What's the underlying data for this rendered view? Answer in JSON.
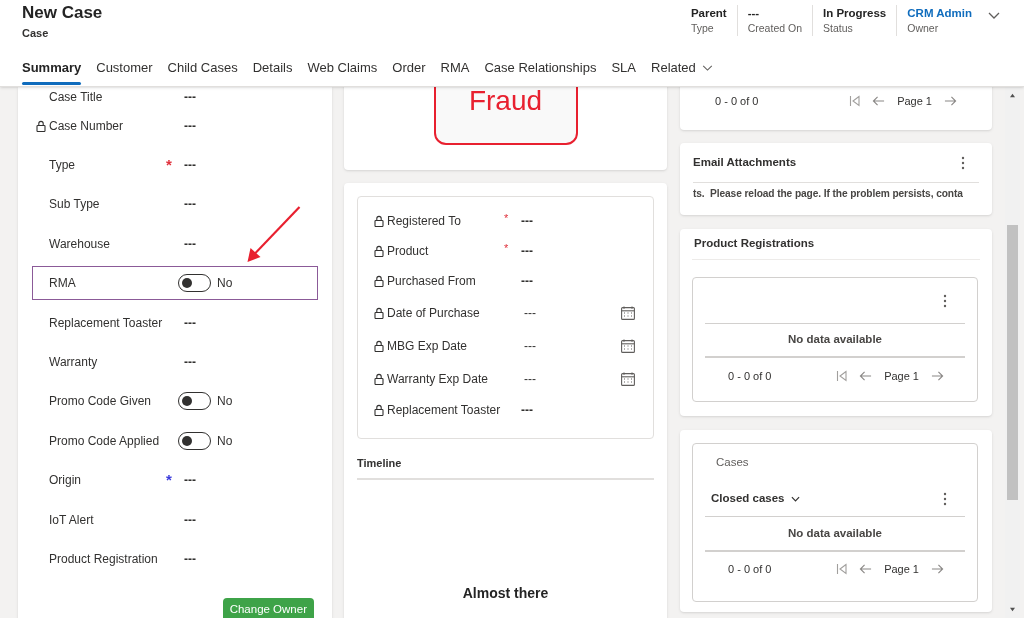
{
  "header": {
    "title": "New Case",
    "subtitle": "Case",
    "fields": [
      {
        "value": "Parent",
        "label": "Type",
        "kind": "text"
      },
      {
        "value": "---",
        "label": "Created On",
        "kind": "text"
      },
      {
        "value": "In Progress",
        "label": "Status",
        "kind": "text"
      },
      {
        "value": "CRM Admin",
        "label": "Owner",
        "kind": "link"
      }
    ],
    "tabs": [
      {
        "label": "Summary",
        "selected": true,
        "dropdown": false
      },
      {
        "label": "Customer",
        "selected": false,
        "dropdown": false
      },
      {
        "label": "Child Cases",
        "selected": false,
        "dropdown": false
      },
      {
        "label": "Details",
        "selected": false,
        "dropdown": false
      },
      {
        "label": "Web Claims",
        "selected": false,
        "dropdown": false
      },
      {
        "label": "Order",
        "selected": false,
        "dropdown": false
      },
      {
        "label": "RMA",
        "selected": false,
        "dropdown": false
      },
      {
        "label": "Case Relationships",
        "selected": false,
        "dropdown": false
      },
      {
        "label": "SLA",
        "selected": false,
        "dropdown": false
      },
      {
        "label": "Related",
        "selected": false,
        "dropdown": true
      }
    ]
  },
  "left_fields": [
    {
      "label": "Case Title",
      "kind": "text",
      "value": "---",
      "locked": false,
      "required": false,
      "highlighted": false
    },
    {
      "label": "Case Number",
      "kind": "text",
      "value": "---",
      "locked": true,
      "required": false,
      "highlighted": false
    },
    {
      "label": "Type",
      "kind": "text",
      "value": "---",
      "locked": false,
      "required": true,
      "required_mark": "*",
      "color": "#e0303b",
      "highlighted": false
    },
    {
      "label": "Sub Type",
      "kind": "text",
      "value": "---",
      "locked": false,
      "required": false,
      "highlighted": false
    },
    {
      "label": "Warehouse",
      "kind": "text",
      "value": "---",
      "locked": false,
      "required": false,
      "highlighted": false
    },
    {
      "label": "RMA",
      "kind": "toggle",
      "on": false,
      "value": "No",
      "locked": false,
      "required": false,
      "highlighted": true
    },
    {
      "label": "Replacement Toaster",
      "kind": "text",
      "value": "---",
      "locked": false,
      "required": false,
      "highlighted": false
    },
    {
      "label": "Warranty",
      "kind": "text",
      "value": "---",
      "locked": false,
      "required": false,
      "highlighted": false
    },
    {
      "label": "Promo Code Given",
      "kind": "toggle",
      "on": false,
      "value": "No",
      "locked": false,
      "required": false,
      "highlighted": false
    },
    {
      "label": "Promo Code Applied",
      "kind": "toggle",
      "on": false,
      "value": "No",
      "locked": false,
      "required": false,
      "highlighted": false
    },
    {
      "label": "Origin",
      "kind": "text",
      "value": "---",
      "locked": false,
      "required": true,
      "required_mark": "*",
      "color": "#3b3bdc",
      "highlighted": false
    },
    {
      "label": "IoT Alert",
      "kind": "text",
      "value": "---",
      "locked": false,
      "required": false,
      "highlighted": false
    },
    {
      "label": "Product Registration",
      "kind": "text",
      "value": "---",
      "locked": false,
      "required": false,
      "highlighted": false
    }
  ],
  "change_owner_button": "Change Owner",
  "fraud_stamp": {
    "text": "Fraud"
  },
  "registration_fields": [
    {
      "label": "Registered To",
      "value": "---",
      "locked": true,
      "required": true,
      "required_mark": "*",
      "calendar": false
    },
    {
      "label": "Product",
      "value": "---",
      "locked": true,
      "required": true,
      "required_mark": "*",
      "calendar": false
    },
    {
      "label": "Purchased From",
      "value": "---",
      "locked": true,
      "required": false,
      "calendar": false
    },
    {
      "label": "Date of Purchase",
      "value": "---",
      "locked": true,
      "required": false,
      "calendar": true
    },
    {
      "label": "MBG Exp Date",
      "value": "---",
      "locked": true,
      "required": false,
      "calendar": true
    },
    {
      "label": "Warranty Exp Date",
      "value": "---",
      "locked": true,
      "required": false,
      "calendar": true
    },
    {
      "label": "Replacement Toaster",
      "value": "---",
      "locked": true,
      "required": false,
      "calendar": false
    }
  ],
  "timeline": {
    "title": "Timeline",
    "message": "Almost there"
  },
  "top_pager": {
    "range": "0 - 0 of 0",
    "page": "Page 1"
  },
  "email_attachments": {
    "title": "Email Attachments",
    "message": "ts.  Please reload the page. If the problem persists, conta"
  },
  "product_registrations": {
    "title": "Product Registrations",
    "empty_text": "No data available",
    "range": "0 - 0 of 0",
    "page": "Page 1"
  },
  "cases": {
    "title": "Cases",
    "view": "Closed cases",
    "empty_text": "No data available",
    "range": "0 - 0 of 0",
    "page": "Page 1"
  }
}
